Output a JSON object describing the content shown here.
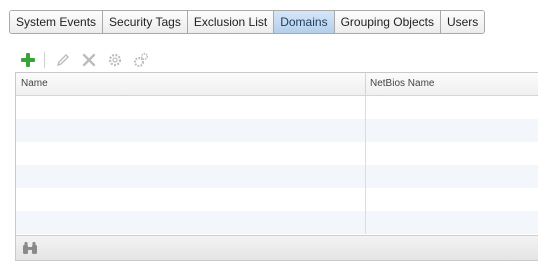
{
  "tabs": [
    {
      "label": "System Events",
      "active": false
    },
    {
      "label": "Security Tags",
      "active": false
    },
    {
      "label": "Exclusion List",
      "active": false
    },
    {
      "label": "Domains",
      "active": true
    },
    {
      "label": "Grouping Objects",
      "active": false
    },
    {
      "label": "Users",
      "active": false
    }
  ],
  "toolbar": {
    "icons": [
      "add-icon",
      "edit-icon",
      "delete-icon",
      "settings-icon",
      "advanced-settings-icon"
    ],
    "add_color": "#3aa336",
    "disabled_color": "#bdbdbd"
  },
  "grid": {
    "columns": [
      "Name",
      "NetBios Name"
    ],
    "rows": [],
    "alt_row_color": "#f3f6fa"
  },
  "footer": {
    "icons": [
      "binoculars-icon"
    ]
  }
}
